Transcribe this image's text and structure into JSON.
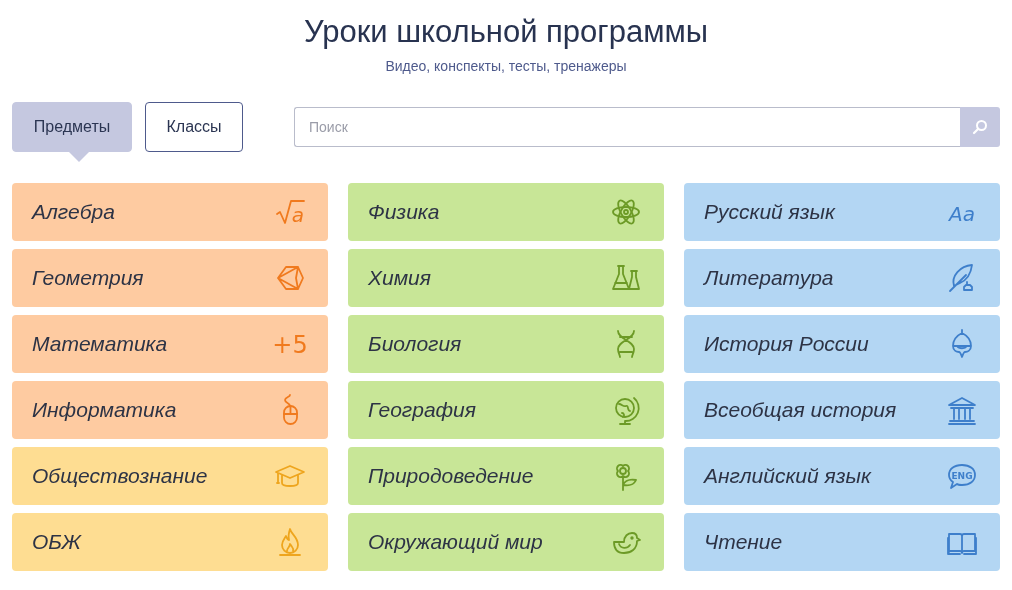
{
  "header": {
    "title": "Уроки школьной программы",
    "subtitle": "Видео, конспекты, тесты, тренажеры"
  },
  "tabs": [
    {
      "label": "Предметы",
      "selected": true
    },
    {
      "label": "Классы",
      "selected": false
    }
  ],
  "search": {
    "placeholder": "Поиск"
  },
  "columns": [
    {
      "subjects": [
        {
          "label": "Алгебра",
          "color": "#fecba1",
          "icon_text": "a"
        },
        {
          "label": "Геометрия",
          "color": "#fecba1"
        },
        {
          "label": "Математика",
          "color": "#fecba1",
          "icon_text": "+5"
        },
        {
          "label": "Информатика",
          "color": "#fecba1"
        },
        {
          "label": "Обществознание",
          "color": "#fedd92"
        },
        {
          "label": "ОБЖ",
          "color": "#fedd92"
        }
      ]
    },
    {
      "subjects": [
        {
          "label": "Физика",
          "color": "#c8e697"
        },
        {
          "label": "Химия",
          "color": "#c8e697"
        },
        {
          "label": "Биология",
          "color": "#c8e697"
        },
        {
          "label": "География",
          "color": "#c8e697"
        },
        {
          "label": "Природоведение",
          "color": "#c8e697"
        },
        {
          "label": "Окружающий мир",
          "color": "#c8e697"
        }
      ]
    },
    {
      "subjects": [
        {
          "label": "Русский язык",
          "color": "#b3d6f3",
          "icon_text": "Aa"
        },
        {
          "label": "Литература",
          "color": "#b3d6f3"
        },
        {
          "label": "История России",
          "color": "#b3d6f3"
        },
        {
          "label": "Всеобщая история",
          "color": "#b3d6f3"
        },
        {
          "label": "Английский язык",
          "color": "#b3d6f3",
          "icon_text": "ENG"
        },
        {
          "label": "Чтение",
          "color": "#b3d6f3"
        }
      ]
    }
  ]
}
